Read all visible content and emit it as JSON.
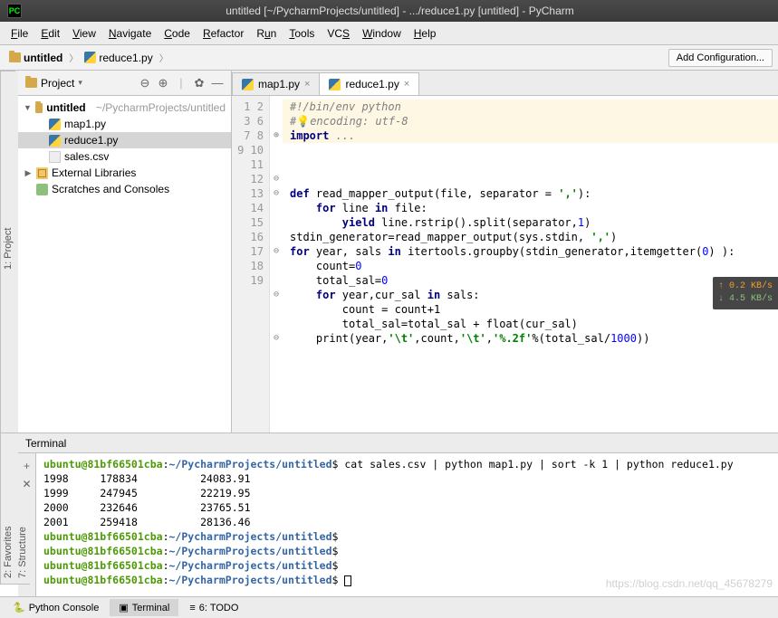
{
  "title": "untitled [~/PycharmProjects/untitled] - .../reduce1.py [untitled] - PyCharm",
  "menu": [
    "File",
    "Edit",
    "View",
    "Navigate",
    "Code",
    "Refactor",
    "Run",
    "Tools",
    "VCS",
    "Window",
    "Help"
  ],
  "breadcrumb": {
    "root": "untitled",
    "file": "reduce1.py"
  },
  "add_config": "Add Configuration...",
  "rail": {
    "project": "1: Project",
    "favorites": "2: Favorites",
    "structure": "7: Structure"
  },
  "project_panel": {
    "title": "Project",
    "root": "untitled",
    "root_path": "~/PycharmProjects/untitled",
    "files": [
      "map1.py",
      "reduce1.py",
      "sales.csv"
    ],
    "external": "External Libraries",
    "scratches": "Scratches and Consoles"
  },
  "tabs": [
    {
      "label": "map1.py",
      "active": false
    },
    {
      "label": "reduce1.py",
      "active": true
    }
  ],
  "gutter": [
    "1",
    "2",
    "3",
    "6",
    "7",
    "8",
    "9",
    "10",
    "11",
    "12",
    "13",
    "14",
    "15",
    "16",
    "17",
    "18",
    "19"
  ],
  "code": {
    "l1": "#!/bin/env python",
    "l2_a": "#",
    "l2_b": "encoding: utf-8",
    "l3": "import ...",
    "l8_a": "def",
    "l8_b": " read_mapper_output(file, separator = ",
    "l8_c": "','",
    "l8_d": "):",
    "l9_a": "    for",
    "l9_b": " line ",
    "l9_c": "in",
    "l9_d": " file:",
    "l10_a": "        yield",
    "l10_b": " line.rstrip().split(separator,",
    "l10_c": "1",
    "l10_d": ")",
    "l11_a": "stdin_generator=read_mapper_output(sys.stdin, ",
    "l11_b": "','",
    "l11_c": ")",
    "l12_a": "for",
    "l12_b": " year, sals ",
    "l12_c": "in",
    "l12_d": " itertools.groupby(stdin_generator,itemgetter(",
    "l12_e": "0",
    "l12_f": ") ):",
    "l13_a": "    count=",
    "l13_b": "0",
    "l14_a": "    total_sal=",
    "l14_b": "0",
    "l15_a": "    for",
    "l15_b": " year,cur_sal ",
    "l15_c": "in",
    "l15_d": " sals:",
    "l16": "        count = count+1",
    "l17_a": "        total_sal=total_sal + float(cur_sal)",
    "l18_a": "    print(year,",
    "l18_b": "'\\t'",
    "l18_c": ",count,",
    "l18_d": "'\\t'",
    "l18_e": ",",
    "l18_f": "'%.2f'",
    "l18_g": "%(total_sal/",
    "l18_h": "1000",
    "l18_i": "))"
  },
  "net": {
    "up": "↑ 0.2 KB/s",
    "down": "↓ 4.5 KB/s"
  },
  "terminal": {
    "title": "Terminal",
    "prompt_user": "ubuntu@81bf66501cba",
    "prompt_path": "~/PycharmProjects/untitled",
    "cmd": "cat sales.csv | python map1.py | sort -k 1 | python reduce1.py",
    "rows": [
      {
        "y": "1998",
        "c": "178834",
        "s": "24083.91"
      },
      {
        "y": "1999",
        "c": "247945",
        "s": "22219.95"
      },
      {
        "y": "2000",
        "c": "232646",
        "s": "23765.51"
      },
      {
        "y": "2001",
        "c": "259418",
        "s": "28136.46"
      }
    ]
  },
  "bottom_tabs": {
    "python_console": "Python Console",
    "terminal": "Terminal",
    "todo": "6: TODO"
  },
  "watermark": "https://blog.csdn.net/qq_45678279"
}
